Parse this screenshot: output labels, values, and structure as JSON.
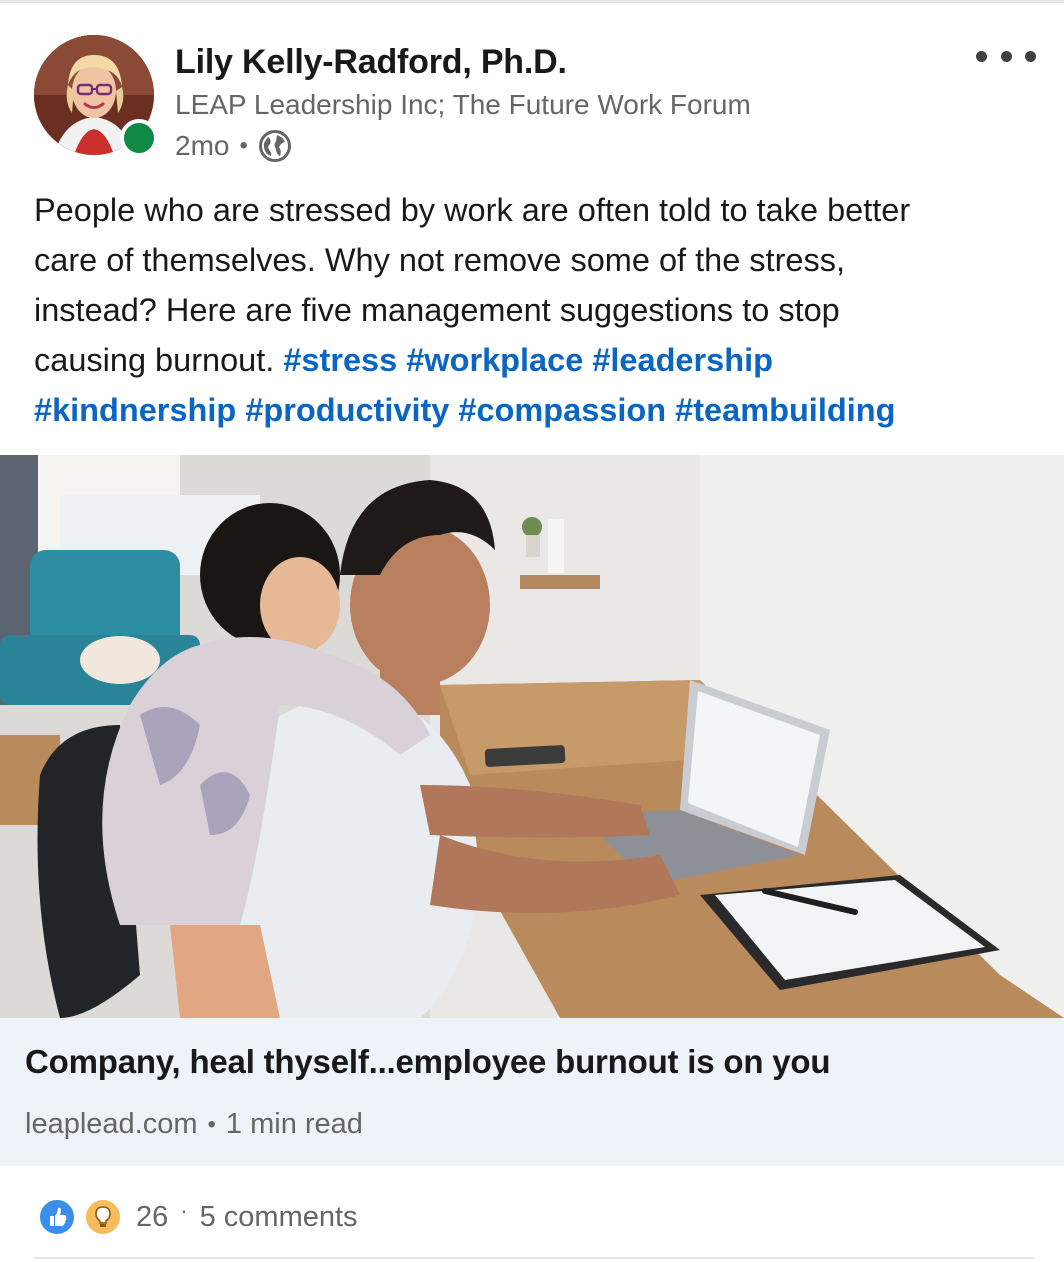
{
  "post": {
    "author": {
      "name": "Lily Kelly-Radford, Ph.D.",
      "headline": "LEAP Leadership Inc; The Future Work Forum",
      "time": "2mo",
      "meta_separator": "•",
      "visibility_icon": "globe-icon",
      "presence_color": "#0e8a45"
    },
    "text_lines": [
      "People who are stressed by work are often told to take better",
      "care of themselves. Why not remove some of the stress,",
      "instead? Here are five management suggestions to stop",
      "causing burnout."
    ],
    "hashtags": [
      "#stress",
      "#workplace",
      "#leadership",
      "#kindnership",
      "#productivity",
      "#compassion",
      "#teambuilding"
    ],
    "article": {
      "title": "Company, heal thyself...employee burnout is on you",
      "source": "leaplead.com",
      "separator": "•",
      "read_time": "1 min read"
    },
    "social": {
      "reactions": [
        "like-icon",
        "insightful-icon"
      ],
      "reaction_count": "26",
      "separator": "·",
      "comments": "5 comments"
    },
    "colors": {
      "link": "#0a66c2",
      "article_bg": "#edf3f8",
      "like": "#378fe9",
      "insightful": "#f5bb5c"
    }
  }
}
